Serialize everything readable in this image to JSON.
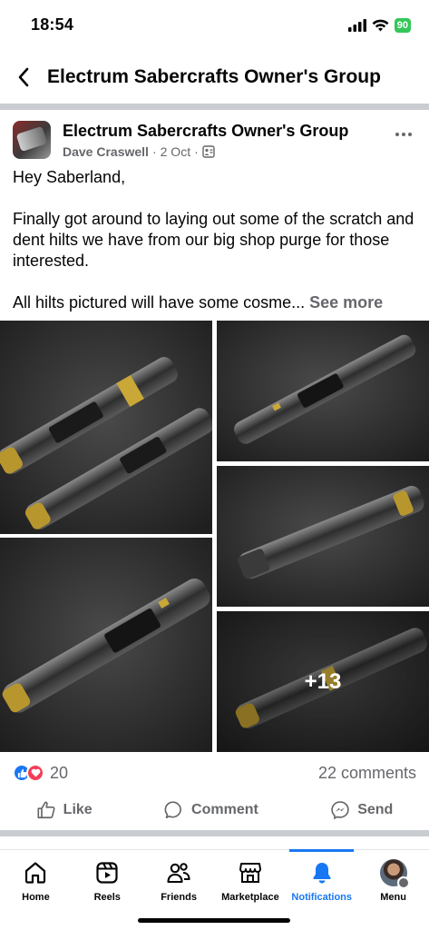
{
  "status_bar": {
    "time": "18:54",
    "battery": "90",
    "icons": [
      "signal-icon",
      "wifi-icon",
      "battery-icon"
    ]
  },
  "header": {
    "title": "Electrum Sabercrafts Owner's Group",
    "back_icon": "chevron-left-icon"
  },
  "post": {
    "group_name": "Electrum Sabercrafts Owner's Group",
    "author": "Dave Craswell",
    "separator": "·",
    "date": "2 Oct",
    "privacy_icon": "group-privacy-icon",
    "paragraphs": [
      "Hey Saberland,",
      "Finally got around to laying out some of the scratch and dent hilts we have from our big shop purge for those interested."
    ],
    "truncated_text": "All hilts pictured will have some cosme...",
    "see_more": "See more",
    "photos": {
      "more_count": "+13",
      "count_shown": 5
    },
    "reactions": {
      "types": [
        "like",
        "love"
      ],
      "count": "20"
    },
    "comments": "22 comments",
    "actions": {
      "like": "Like",
      "comment": "Comment",
      "send": "Send"
    }
  },
  "bottom_nav": {
    "items": [
      {
        "label": "Home",
        "icon": "home-icon"
      },
      {
        "label": "Reels",
        "icon": "reels-icon"
      },
      {
        "label": "Friends",
        "icon": "friends-icon"
      },
      {
        "label": "Marketplace",
        "icon": "marketplace-icon"
      },
      {
        "label": "Notifications",
        "icon": "bell-icon",
        "active": true
      },
      {
        "label": "Menu",
        "icon": "profile-avatar"
      }
    ]
  },
  "colors": {
    "accent": "#1877f2",
    "secondary_text": "#65676b",
    "divider": "#c9ccd1",
    "love": "#f33e58",
    "battery": "#34c759"
  }
}
